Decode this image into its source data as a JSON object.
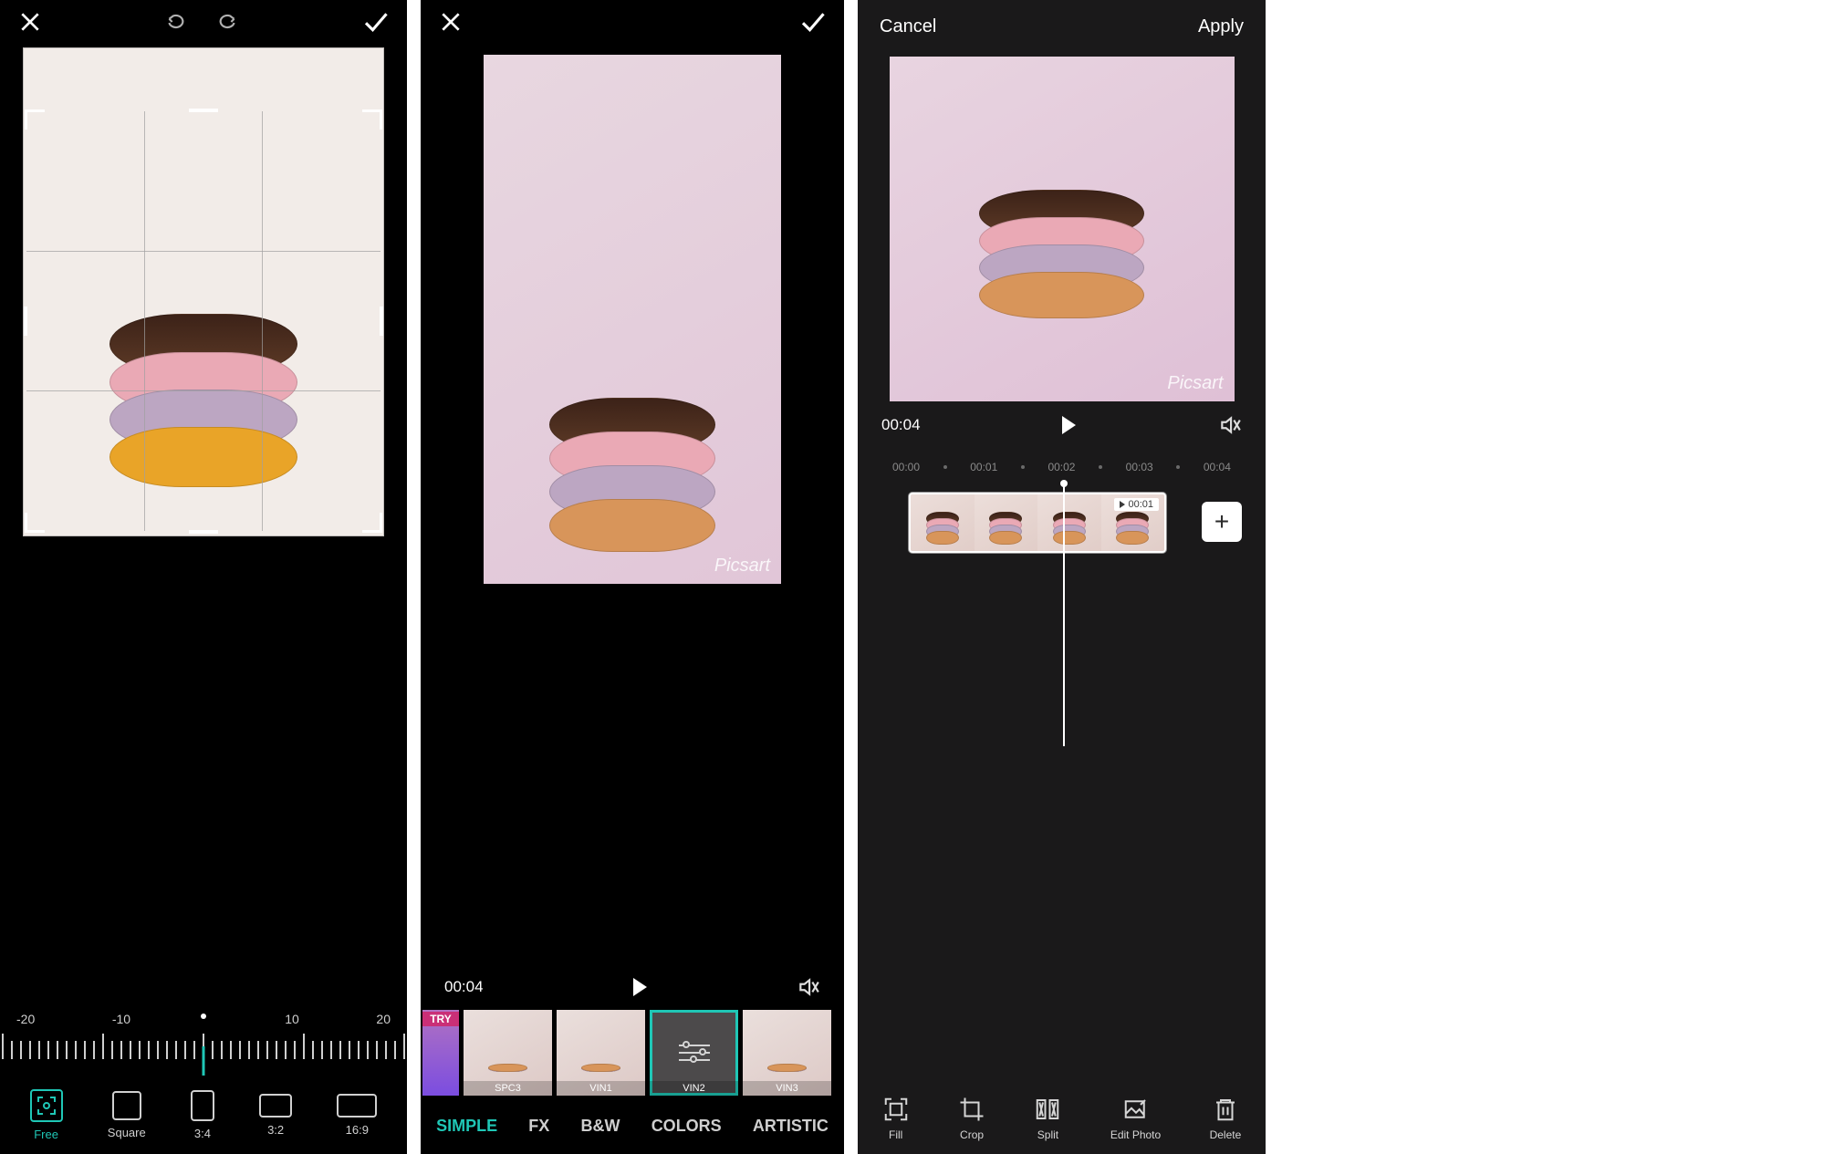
{
  "screen1": {
    "ruler": {
      "m20n": "-20",
      "m10n": "-10",
      "p10": "10",
      "p20": "20"
    },
    "ratios": {
      "free": "Free",
      "square": "Square",
      "r34": "3:4",
      "r32": "3:2",
      "r169": "16:9"
    }
  },
  "screen2": {
    "time": "00:04",
    "watermark": "Picsart",
    "filters": {
      "try": "TRY",
      "spc3": "SPC3",
      "vin1": "VIN1",
      "vin2": "VIN2",
      "vin3": "VIN3"
    },
    "cats": {
      "simple": "SIMPLE",
      "fx": "FX",
      "bw": "B&W",
      "colors": "COLORS",
      "artistic": "ARTISTIC"
    }
  },
  "screen3": {
    "cancel": "Cancel",
    "apply": "Apply",
    "time": "00:04",
    "watermark": "Picsart",
    "timeline": {
      "t0": "00:00",
      "t1": "00:01",
      "t2": "00:02",
      "t3": "00:03",
      "t4": "00:04",
      "clip_badge": "00:01"
    },
    "tools": {
      "fill": "Fill",
      "crop": "Crop",
      "split": "Split",
      "edit": "Edit Photo",
      "delete": "Delete"
    }
  }
}
